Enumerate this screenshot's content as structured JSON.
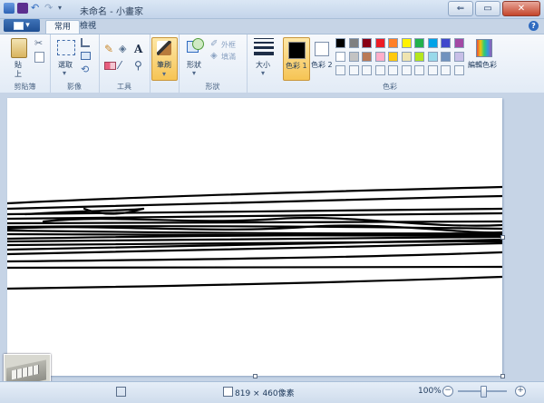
{
  "window": {
    "title": "未命名 - 小畫家",
    "buttons": {
      "minimize": "⇐",
      "maximize": "▭",
      "close": "✕"
    }
  },
  "tabs": {
    "home": "常用",
    "view": "檢視",
    "help": "?"
  },
  "ribbon": {
    "clipboard": {
      "paste": "貼",
      "paste2": "上",
      "label": "剪貼簿"
    },
    "image": {
      "select": "選取",
      "label": "影像"
    },
    "tools": {
      "text_tool": "A",
      "label": "工具"
    },
    "brushes": {
      "label": "筆刷"
    },
    "shapes": {
      "shapes_label": "形狀",
      "outline": "外框",
      "fill": "填滿",
      "label": "形狀"
    },
    "size": {
      "label": "大小"
    },
    "colors": {
      "color1": "色彩 1",
      "color2": "色彩 2",
      "edit": "編輯色彩",
      "label": "色彩",
      "palette_row1": [
        "#000000",
        "#7f7f7f",
        "#880015",
        "#ed1c24",
        "#ff7f27",
        "#fff200",
        "#22b14c",
        "#00a2e8",
        "#3f48cc",
        "#a349a4"
      ],
      "palette_row2": [
        "#ffffff",
        "#c3c3c3",
        "#b97a57",
        "#ffaec9",
        "#ffc90e",
        "#efe4b0",
        "#b5e61d",
        "#99d9ea",
        "#7092be",
        "#c8bfe7"
      ]
    }
  },
  "status": {
    "size": "819 × 460像素",
    "zoom": "100%",
    "minus": "−",
    "plus": "+"
  }
}
